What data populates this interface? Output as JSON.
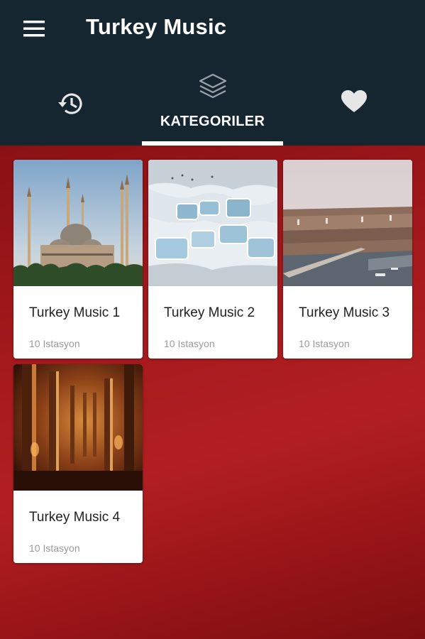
{
  "app": {
    "title": "Turkey Music"
  },
  "tabs": [
    {
      "id": "history",
      "icon": "history-icon",
      "label": ""
    },
    {
      "id": "categories",
      "icon": "layers-icon",
      "label": "KATEGORILER",
      "selected": true
    },
    {
      "id": "favorites",
      "icon": "heart-icon",
      "label": ""
    }
  ],
  "colors": {
    "topbar": "#162631",
    "background": "#a3191c",
    "card": "#ffffff",
    "indicator": "#ffffff"
  },
  "categories": [
    {
      "title": "Turkey Music 1",
      "subtitle": "10 Istasyon",
      "image": "blue-mosque-photo"
    },
    {
      "title": "Turkey Music 2",
      "subtitle": "10 Istasyon",
      "image": "pamukkale-terraces-photo"
    },
    {
      "title": "Turkey Music 3",
      "subtitle": "10 Istasyon",
      "image": "istanbul-cityscape-photo"
    },
    {
      "title": "Turkey Music 4",
      "subtitle": "10 Istasyon",
      "image": "basilica-cistern-photo"
    }
  ]
}
